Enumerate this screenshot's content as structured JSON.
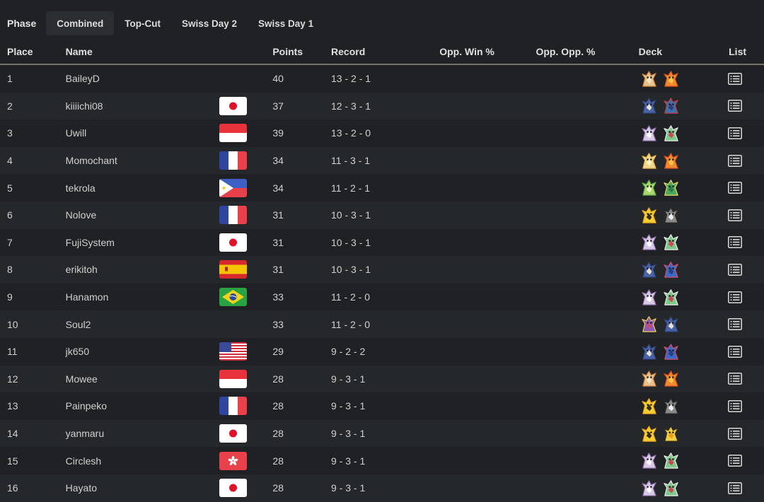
{
  "phase": {
    "label": "Phase",
    "tabs": [
      {
        "label": "Combined",
        "active": true
      },
      {
        "label": "Top-Cut",
        "active": false
      },
      {
        "label": "Swiss Day 2",
        "active": false
      },
      {
        "label": "Swiss Day 1",
        "active": false
      }
    ]
  },
  "table": {
    "headers": {
      "place": "Place",
      "name": "Name",
      "points": "Points",
      "record": "Record",
      "opp_win": "Opp. Win %",
      "opp_opp": "Opp. Opp. %",
      "deck": "Deck",
      "list": "List"
    },
    "rows": [
      {
        "place": "1",
        "name": "BaileyD",
        "flag": "",
        "points": "40",
        "record": "13 - 2 - 1",
        "deck": [
          "arcanine-icon",
          "moltres-icon"
        ]
      },
      {
        "place": "2",
        "name": "kiiiichi08",
        "flag": "jp",
        "points": "37",
        "record": "12 - 3 - 1",
        "deck": [
          "garchomp-icon",
          "dragapult-icon"
        ]
      },
      {
        "place": "3",
        "name": "Uwill",
        "flag": "id",
        "points": "39",
        "record": "13 - 2 - 0",
        "deck": [
          "mewtwo-icon",
          "gardevoir-icon"
        ]
      },
      {
        "place": "4",
        "name": "Momochant",
        "flag": "fr",
        "points": "34",
        "record": "11 - 3 - 1",
        "deck": [
          "ninetales-icon",
          "moltres-icon"
        ]
      },
      {
        "place": "5",
        "name": "tekrola",
        "flag": "ph",
        "points": "34",
        "record": "11 - 2 - 1",
        "deck": [
          "celebi-icon",
          "serperior-icon"
        ]
      },
      {
        "place": "6",
        "name": "Nolove",
        "flag": "fr",
        "points": "31",
        "record": "10 - 3 - 1",
        "deck": [
          "pikachu-icon",
          "zebstrika-icon"
        ]
      },
      {
        "place": "7",
        "name": "FujiSystem",
        "flag": "jp",
        "points": "31",
        "record": "10 - 3 - 1",
        "deck": [
          "mewtwo-icon",
          "gardevoir-icon"
        ]
      },
      {
        "place": "8",
        "name": "erikitoh",
        "flag": "es",
        "points": "31",
        "record": "10 - 3 - 1",
        "deck": [
          "garchomp-icon",
          "greninja-icon"
        ]
      },
      {
        "place": "9",
        "name": "Hanamon",
        "flag": "br",
        "points": "33",
        "record": "11 - 2 - 0",
        "deck": [
          "mewtwo-icon",
          "gardevoir-icon"
        ]
      },
      {
        "place": "10",
        "name": "Soul2",
        "flag": "",
        "points": "33",
        "record": "11 - 2 - 0",
        "deck": [
          "starmie-icon",
          "garchomp-icon"
        ]
      },
      {
        "place": "11",
        "name": "jk650",
        "flag": "us",
        "points": "29",
        "record": "9 - 2 - 2",
        "deck": [
          "garchomp-icon",
          "greninja-icon"
        ]
      },
      {
        "place": "12",
        "name": "Mowee",
        "flag": "id",
        "points": "28",
        "record": "9 - 3 - 1",
        "deck": [
          "arcanine-icon",
          "moltres-icon"
        ]
      },
      {
        "place": "13",
        "name": "Painpeko",
        "flag": "fr",
        "points": "28",
        "record": "9 - 3 - 1",
        "deck": [
          "pikachu-icon",
          "zebstrika-icon"
        ]
      },
      {
        "place": "14",
        "name": "yanmaru",
        "flag": "jp",
        "points": "28",
        "record": "9 - 3 - 1",
        "deck": [
          "pikachu-icon",
          "zapdos-icon"
        ]
      },
      {
        "place": "15",
        "name": "Circlesh",
        "flag": "hk",
        "points": "28",
        "record": "9 - 3 - 1",
        "deck": [
          "mewtwo-icon",
          "gardevoir-icon"
        ]
      },
      {
        "place": "16",
        "name": "Hayato",
        "flag": "jp",
        "points": "28",
        "record": "9 - 3 - 1",
        "deck": [
          "mewtwo-icon",
          "gardevoir-icon"
        ]
      }
    ]
  },
  "colors": {
    "background": "#1f2124",
    "row_alt": "#25282b",
    "active_tab": "#2b2e31",
    "header_rule": "#76716a",
    "text": "#d0d0d0"
  }
}
